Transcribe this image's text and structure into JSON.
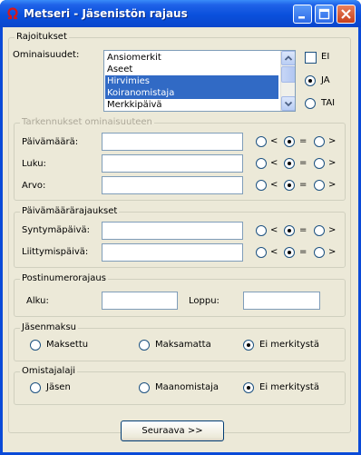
{
  "window": {
    "title": "Metseri - Jäsenistön rajaus",
    "minimize": "_",
    "maximize": "□",
    "close": "✕",
    "icon": "omega-icon"
  },
  "rajoitukset": {
    "legend": "Rajoitukset",
    "ominaisuudet_label": "Ominaisuudet:",
    "list_items": [
      "Ansiomerkit",
      "Aseet",
      "Hirvimies",
      "Koiranomistaja",
      "Merkkipäivä"
    ],
    "selected_items": [
      "Hirvimies",
      "Koiranomistaja"
    ],
    "ei_label": "EI",
    "ja_label": "JA",
    "tai_label": "TAI",
    "logic_selected": "JA"
  },
  "tarkennukset": {
    "legend": "Tarkennukset ominaisuuteen",
    "rows": [
      {
        "label": "Päivämäärä:",
        "value": ""
      },
      {
        "label": "Luku:",
        "value": ""
      },
      {
        "label": "Arvo:",
        "value": ""
      }
    ]
  },
  "comparators": {
    "lt": "<",
    "eq": "=",
    "gt": ">",
    "selected": "="
  },
  "paivamaararajaukset": {
    "legend": "Päivämäärärajaukset",
    "rows": [
      {
        "label": "Syntymäpäivä:",
        "value": ""
      },
      {
        "label": "Liittymispäivä:",
        "value": ""
      }
    ]
  },
  "postinumerorajaus": {
    "legend": "Postinumerorajaus",
    "alku_label": "Alku:",
    "alku_value": "",
    "loppu_label": "Loppu:",
    "loppu_value": ""
  },
  "jasenmaksu": {
    "legend": "Jäsenmaksu",
    "options": [
      "Maksettu",
      "Maksamatta",
      "Ei merkitystä"
    ],
    "selected": "Ei merkitystä"
  },
  "omistajalaji": {
    "legend": "Omistajalaji",
    "options": [
      "Jäsen",
      "Maanomistaja",
      "Ei merkitystä"
    ],
    "selected": "Ei merkitystä"
  },
  "footer": {
    "next_button": "Seuraava >>"
  }
}
